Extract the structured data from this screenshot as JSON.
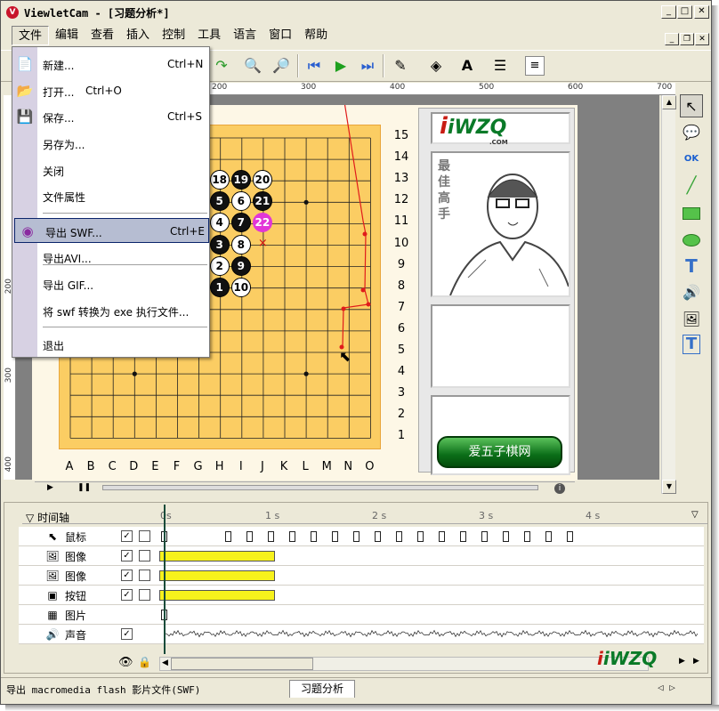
{
  "window": {
    "title": "ViewletCam - [习题分析*]",
    "icon": "viewletcam-icon"
  },
  "menubar": [
    "文件",
    "编辑",
    "查看",
    "插入",
    "控制",
    "工具",
    "语言",
    "窗口",
    "帮助"
  ],
  "file_menu": {
    "items": [
      {
        "label": "新建...",
        "shortcut": "Ctrl+N",
        "icon": "new-file-icon"
      },
      {
        "label": "打开...",
        "shortcut": "Ctrl+O",
        "icon": "open-folder-icon"
      },
      {
        "label": "保存...",
        "shortcut": "Ctrl+S",
        "icon": "save-disk-icon"
      },
      {
        "label": "另存为...",
        "shortcut": ""
      },
      {
        "label": "关闭",
        "shortcut": ""
      },
      {
        "label": "文件属性",
        "shortcut": ""
      },
      {
        "label": "导出 SWF...",
        "shortcut": "Ctrl+E",
        "icon": "export-swf-icon",
        "highlighted": true
      },
      {
        "label": "导出AVI...",
        "shortcut": ""
      },
      {
        "label": "导出 GIF...",
        "shortcut": ""
      },
      {
        "label": "将 swf 转换为 exe 执行文件...",
        "shortcut": ""
      },
      {
        "label": "退出",
        "shortcut": ""
      }
    ]
  },
  "ruler": {
    "h": [
      "200",
      "300",
      "400",
      "500",
      "600",
      "700"
    ],
    "v": [
      "200",
      "300",
      "400"
    ]
  },
  "board": {
    "row_labels": [
      "15",
      "14",
      "13",
      "12",
      "11",
      "10",
      "9",
      "8",
      "7",
      "6",
      "5",
      "4",
      "3",
      "2",
      "1"
    ],
    "col_labels": [
      "A",
      "B",
      "C",
      "D",
      "E",
      "F",
      "G",
      "H",
      "I",
      "J",
      "K",
      "L",
      "M",
      "N",
      "O"
    ],
    "stones": [
      {
        "n": "18",
        "c": "w"
      },
      {
        "n": "19",
        "c": "b"
      },
      {
        "n": "20",
        "c": "w"
      },
      {
        "n": "5",
        "c": "b"
      },
      {
        "n": "6",
        "c": "w"
      },
      {
        "n": "21",
        "c": "b"
      },
      {
        "n": "4",
        "c": "w"
      },
      {
        "n": "7",
        "c": "b"
      },
      {
        "n": "22",
        "c": "m"
      },
      {
        "n": "3",
        "c": "b"
      },
      {
        "n": "8",
        "c": "w"
      },
      {
        "n": "2",
        "c": "w"
      },
      {
        "n": "9",
        "c": "b"
      },
      {
        "n": "1",
        "c": "b"
      },
      {
        "n": "10",
        "c": "w"
      }
    ],
    "last_move_mark": "×"
  },
  "side_panel": {
    "logo_text": "iWZQ",
    "logo_sub": ".COM",
    "portrait_caption": "最佳高手",
    "site_button": "爱五子棋网"
  },
  "timeline": {
    "header": "时间轴",
    "ticks": [
      "0s",
      "1 s",
      "2 s",
      "3 s",
      "4 s"
    ],
    "layers": [
      {
        "name": "鼠标",
        "icon": "cursor-icon",
        "visible": true,
        "locked": false
      },
      {
        "name": "图像",
        "icon": "image-icon",
        "visible": true,
        "locked": false
      },
      {
        "name": "图像",
        "icon": "image-icon",
        "visible": true,
        "locked": false
      },
      {
        "name": "按钮",
        "icon": "button-icon",
        "visible": true,
        "locked": false
      },
      {
        "name": "图片",
        "icon": "picture-icon"
      },
      {
        "name": "声音",
        "icon": "sound-icon",
        "visible": true
      }
    ]
  },
  "status": {
    "text": "导出 macromedia flash 影片文件(SWF)",
    "tab": "习题分析",
    "nav": "◁ ▷"
  }
}
